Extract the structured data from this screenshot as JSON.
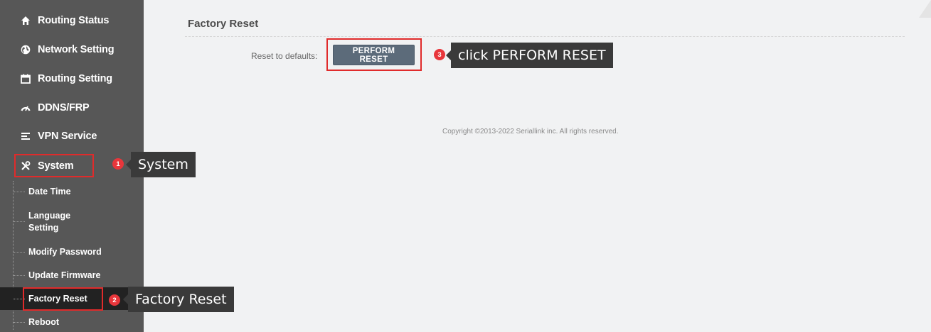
{
  "sidebar": {
    "items": [
      {
        "label": "Routing Status",
        "icon": "home-icon"
      },
      {
        "label": "Network Setting",
        "icon": "globe-icon"
      },
      {
        "label": "Routing Setting",
        "icon": "calendar-icon"
      },
      {
        "label": "DDNS/FRP",
        "icon": "gauge-icon"
      },
      {
        "label": "VPN Service",
        "icon": "list-icon"
      },
      {
        "label": "System",
        "icon": "tools-icon"
      }
    ],
    "submenu": [
      {
        "label": "Date Time"
      },
      {
        "label": "Language\nSetting"
      },
      {
        "label": "Modify Password"
      },
      {
        "label": "Update Firmware"
      },
      {
        "label": "Factory Reset",
        "active": true
      },
      {
        "label": "Reboot"
      }
    ]
  },
  "main": {
    "title": "Factory Reset",
    "reset_label": "Reset to defaults:",
    "perform_button": "PERFORM RESET",
    "copyright": "Copyright ©2013-2022 Seriallink inc. All rights reserved."
  },
  "annotations": {
    "steps": [
      {
        "number": "1",
        "text": "System"
      },
      {
        "number": "2",
        "text": "Factory Reset"
      },
      {
        "number": "3",
        "text": "click PERFORM RESET"
      }
    ],
    "highlight_color": "#e02b2b"
  },
  "colors": {
    "sidebar_bg": "#575757",
    "active_bg": "#222222",
    "button_bg": "#5c6b7a",
    "main_bg": "#f1f2f3"
  }
}
